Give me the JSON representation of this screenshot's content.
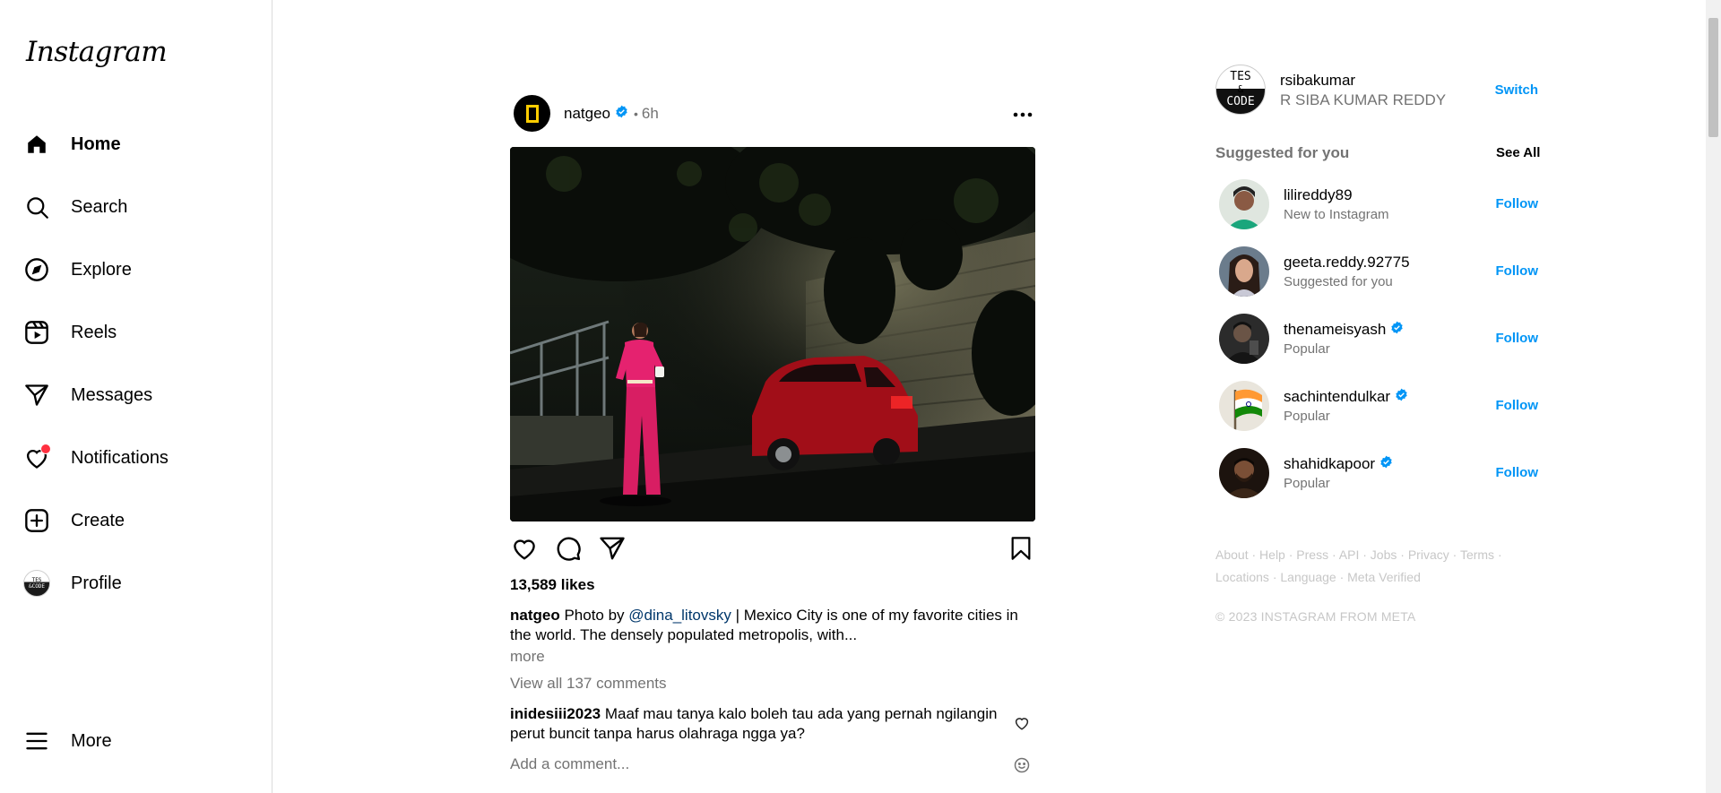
{
  "app": {
    "logo_text": "Instagram"
  },
  "sidebar": {
    "items": [
      {
        "label": "Home",
        "icon": "home-icon",
        "active": true
      },
      {
        "label": "Search",
        "icon": "search-icon"
      },
      {
        "label": "Explore",
        "icon": "compass-icon"
      },
      {
        "label": "Reels",
        "icon": "reels-icon"
      },
      {
        "label": "Messages",
        "icon": "paper-plane-icon"
      },
      {
        "label": "Notifications",
        "icon": "heart-icon",
        "badge_dot": true
      },
      {
        "label": "Create",
        "icon": "plus-square-icon"
      },
      {
        "label": "Profile",
        "icon": "profile-avatar"
      }
    ],
    "more_label": "More",
    "profile_avatar_text": {
      "top": "TES",
      "bottom": "&CODE"
    }
  },
  "post": {
    "username": "natgeo",
    "verified": true,
    "separator": "•",
    "time": "6h",
    "likes": "13,589 likes",
    "caption": {
      "username": "natgeo",
      "text_before": " Photo by ",
      "mention": "@dina_litovsky",
      "text_after": " | Mexico City is one of my favorite cities in the world. The densely populated metropolis, with..."
    },
    "more_label": "more",
    "view_comments": "View all 137 comments",
    "top_comment": {
      "username": "inidesiii2023",
      "text": " Maaf mau tanya kalo boleh tau ada yang pernah ngilangin perut buncit tanpa harus olahraga ngga ya?"
    },
    "add_comment_placeholder": "Add a comment..."
  },
  "current_user": {
    "username": "rsibakumar",
    "full_name": "R SIBA KUMAR REDDY",
    "switch_label": "Switch",
    "avatar_text": [
      "TES",
      "&",
      "CODE"
    ]
  },
  "suggestions": {
    "title": "Suggested for you",
    "see_all": "See All",
    "follow_label": "Follow",
    "items": [
      {
        "username": "lilireddy89",
        "subtitle": "New to Instagram",
        "verified": false
      },
      {
        "username": "geeta.reddy.92775",
        "subtitle": "Suggested for you",
        "verified": false
      },
      {
        "username": "thenameisyash",
        "subtitle": "Popular",
        "verified": true
      },
      {
        "username": "sachintendulkar",
        "subtitle": "Popular",
        "verified": true
      },
      {
        "username": "shahidkapoor",
        "subtitle": "Popular",
        "verified": true
      }
    ]
  },
  "footer": {
    "links": [
      "About",
      "Help",
      "Press",
      "API",
      "Jobs",
      "Privacy",
      "Terms",
      "Locations",
      "Language",
      "Meta Verified"
    ],
    "separator": " · ",
    "copyright": "© 2023 INSTAGRAM FROM META"
  },
  "colors": {
    "link_blue": "#0095f6",
    "mention_blue": "#00376b",
    "secondary_text": "#737373",
    "notification_red": "#ff3040",
    "verified_blue": "#0095f6",
    "natgeo_yellow": "#ffcd00"
  }
}
